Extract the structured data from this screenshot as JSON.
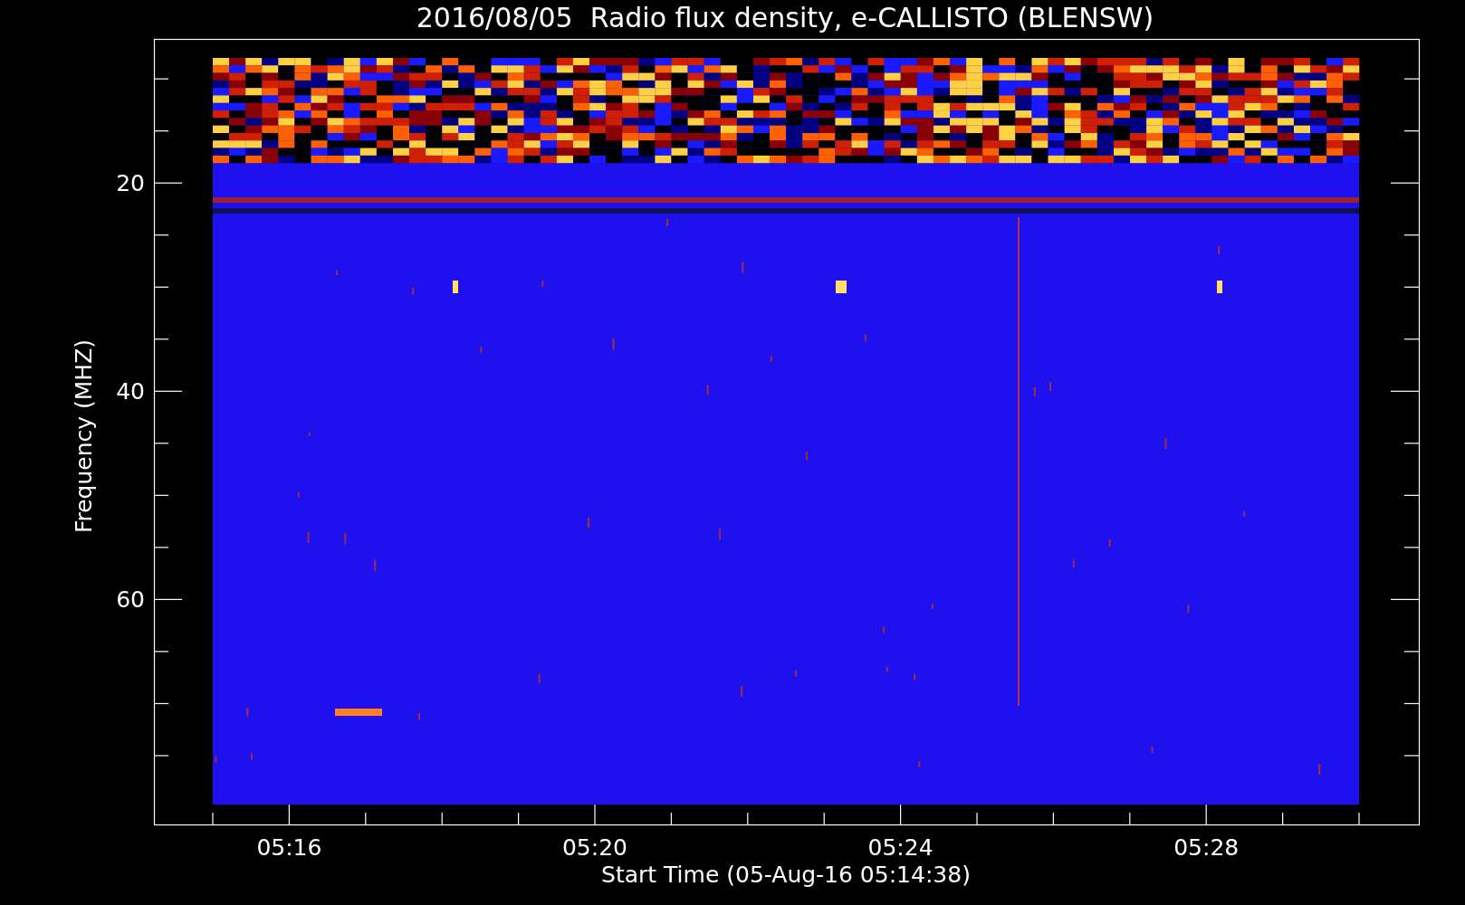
{
  "title": "2016/08/05  Radio flux density, e-CALLISTO (BLENSW)",
  "y_axis": {
    "label": "Frequency (MHZ)",
    "ticks": [
      "20",
      "40",
      "60"
    ]
  },
  "x_axis": {
    "label": "Start Time (05-Aug-16 05:14:38)",
    "ticks": [
      "05:16",
      "05:20",
      "05:24",
      "05:28"
    ]
  }
}
